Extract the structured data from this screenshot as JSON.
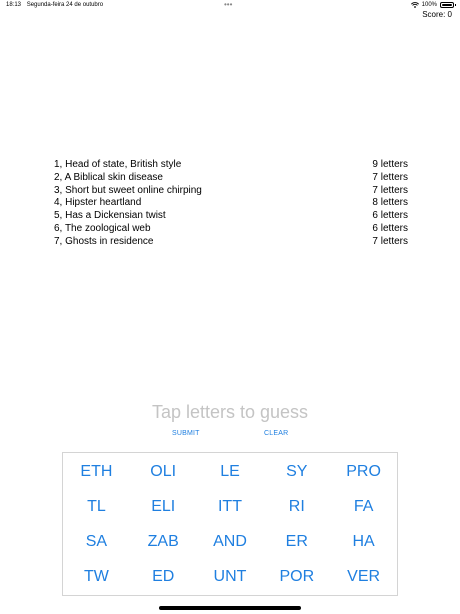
{
  "status_bar": {
    "time": "18:13",
    "date": "Segunda-feira 24 de outubro",
    "dots": "•••",
    "battery_percent": "100%"
  },
  "score_label": "Score: 0",
  "clues": [
    {
      "text": "1, Head of state, British style",
      "length": "9 letters"
    },
    {
      "text": "2, A Biblical skin disease",
      "length": "7 letters"
    },
    {
      "text": "3, Short but sweet online chirping",
      "length": "7 letters"
    },
    {
      "text": "4, Hipster heartland",
      "length": "8 letters"
    },
    {
      "text": "5, Has a Dickensian twist",
      "length": "6 letters"
    },
    {
      "text": "6, The zoological web",
      "length": "6 letters"
    },
    {
      "text": "7, Ghosts in residence",
      "length": "7 letters"
    }
  ],
  "guess_prompt": "Tap letters to guess",
  "actions": {
    "submit": "SUBMIT",
    "clear": "CLEAR"
  },
  "tiles": [
    "ETH",
    "OLI",
    "LE",
    "SY",
    "PRO",
    "TL",
    "ELI",
    "ITT",
    "RI",
    "FA",
    "SA",
    "ZAB",
    "AND",
    "ER",
    "HA",
    "TW",
    "ED",
    "UNT",
    "POR",
    "VER"
  ],
  "colors": {
    "accent": "#1f7fe0",
    "placeholder": "#c4c4c4",
    "grid_border": "#d4d4d4"
  }
}
